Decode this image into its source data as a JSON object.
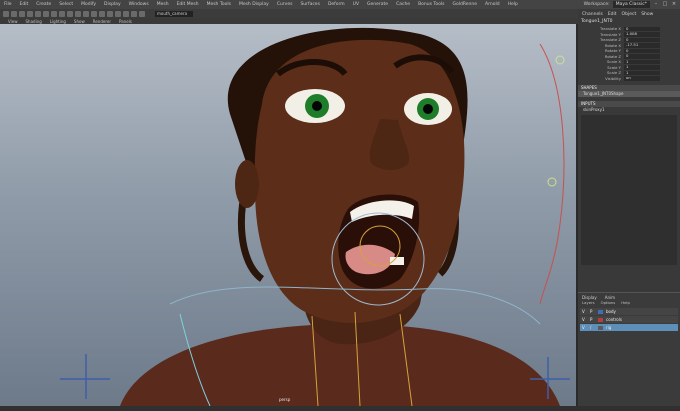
{
  "menubar": {
    "items": [
      "File",
      "Edit",
      "Create",
      "Select",
      "Modify",
      "Display",
      "Windows",
      "Mesh",
      "Edit Mesh",
      "Mesh Tools",
      "Mesh Display",
      "Curves",
      "Surfaces",
      "Deform",
      "UV",
      "Generate",
      "Cache",
      "Bonus Tools",
      "GoldRenne",
      "Arnold",
      "Help"
    ],
    "workspace_label": "Workspace:",
    "workspace_value": "Maya Classic*"
  },
  "toolbar": {
    "field_value": "mouth_camera"
  },
  "panel_menu": {
    "items": [
      "View",
      "Shading",
      "Lighting",
      "Show",
      "Renderer",
      "Panels"
    ]
  },
  "viewport": {
    "camera_label": "persp"
  },
  "channel_box": {
    "tabs": [
      "Channels",
      "Edit",
      "Object",
      "Show"
    ],
    "object_name": "Tongue1_JNT0",
    "attributes": [
      {
        "name": "Translate X",
        "value": "0"
      },
      {
        "name": "Translate Y",
        "value": "1.008"
      },
      {
        "name": "Translate Z",
        "value": "0"
      },
      {
        "name": "Rotate X",
        "value": "-17.51"
      },
      {
        "name": "Rotate Y",
        "value": "0"
      },
      {
        "name": "Rotate Z",
        "value": "0"
      },
      {
        "name": "Scale X",
        "value": "1"
      },
      {
        "name": "Scale Y",
        "value": "1"
      },
      {
        "name": "Scale Z",
        "value": "1"
      },
      {
        "name": "Visibility",
        "value": "on"
      }
    ],
    "shapes_header": "SHAPES",
    "shapes_item": "Tongue1_JNT0Shape",
    "inputs_header": "INPUTS",
    "inputs_item": "skinProxy1"
  },
  "layer_editor": {
    "tabs": [
      "Display",
      "Anim"
    ],
    "menu": [
      "Layers",
      "Options",
      "Help"
    ],
    "layers": [
      {
        "v": "V",
        "p": "P",
        "color": "#3f6fb0",
        "name": "body",
        "selected": false
      },
      {
        "v": "V",
        "p": "P",
        "color": "#b04040",
        "name": "controls",
        "selected": false
      },
      {
        "v": "V",
        "p": "/",
        "color": "#5a5a5a",
        "name": "rig",
        "selected": true
      }
    ]
  },
  "colors": {
    "skin": "#5a2d17",
    "iris": "#1f7d2a",
    "ui_bg": "#393939",
    "selected": "#5d8fb8"
  }
}
